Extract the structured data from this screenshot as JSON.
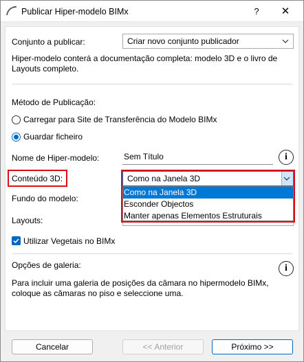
{
  "window": {
    "title": "Publicar Hiper-modelo BIMx",
    "help_label": "?",
    "close_label": "✕"
  },
  "set": {
    "label": "Conjunto a publicar:",
    "value": "Criar novo conjunto publicador",
    "description": "Hiper-modelo conterá a documentação completa: modelo 3D e o livro de Layouts completo."
  },
  "publish_method": {
    "heading": "Método de Publicação:",
    "options": [
      {
        "label": "Carregar para Site de Transferência do Modelo BIMx",
        "checked": false
      },
      {
        "label": "Guardar ficheiro",
        "checked": true
      }
    ]
  },
  "hypermodel_name": {
    "label": "Nome de Hiper-modelo:",
    "value": "Sem Título",
    "info_icon": "info-icon"
  },
  "content_3d": {
    "label": "Conteúdo 3D:",
    "value": "Como na Janela 3D",
    "options": [
      "Como na Janela 3D",
      "Esconder Objectos",
      "Manter apenas Elementos Estruturais"
    ],
    "selected_index": 0
  },
  "model_background": {
    "label": "Fundo do modelo:"
  },
  "layouts": {
    "label": "Layouts:"
  },
  "vegetation": {
    "label": "Utilizar Vegetais no BIMx",
    "checked": true
  },
  "gallery": {
    "heading": "Opções de galeria:",
    "description": "Para incluir uma galeria de posições da câmara no hipermodelo BIMx, coloque as câmaras no piso e seleccione uma."
  },
  "footer": {
    "cancel": "Cancelar",
    "previous": "<< Anterior",
    "next": "Próximo >>"
  },
  "colors": {
    "accent": "#0067c0",
    "highlight_border": "#d90e17",
    "selection": "#0078d7"
  }
}
